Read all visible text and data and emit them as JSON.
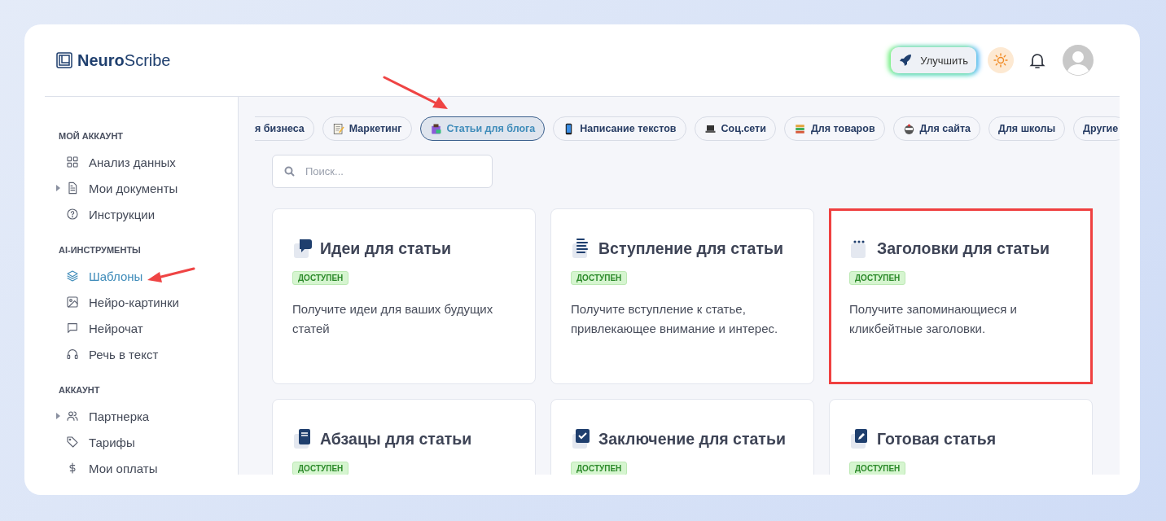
{
  "brand": {
    "logo": "**Neuro**Scribe"
  },
  "header": {
    "upgrade_button": "Улучшить"
  },
  "sidebar": {
    "sections": [
      {
        "title": "МОЙ АККАУНТ",
        "items": [
          {
            "label": "Анализ данных",
            "selected": false,
            "has_submenu": false
          },
          {
            "label": "Мои документы",
            "selected": false,
            "has_submenu": true
          },
          {
            "label": "Инструкции",
            "selected": false,
            "has_submenu": false
          }
        ]
      },
      {
        "title": "AI-ИНСТРУМЕНТЫ",
        "items": [
          {
            "label": "Шаблоны",
            "selected": true,
            "has_submenu": false
          },
          {
            "label": "Нейро-картинки",
            "selected": false,
            "has_submenu": false
          },
          {
            "label": "Нейрочат",
            "selected": false,
            "has_submenu": false
          },
          {
            "label": "Речь в текст",
            "selected": false,
            "has_submenu": false
          }
        ]
      },
      {
        "title": "АККАУНТ",
        "items": [
          {
            "label": "Партнерка",
            "selected": false,
            "has_submenu": true
          },
          {
            "label": "Тарифы",
            "selected": false,
            "has_submenu": false
          },
          {
            "label": "Мои оплаты",
            "selected": false,
            "has_submenu": false
          }
        ]
      }
    ]
  },
  "categories": [
    {
      "label": "я бизнеса",
      "selected": false
    },
    {
      "label": "Маркетинг",
      "selected": false
    },
    {
      "label": "Статьи для блога",
      "selected": true
    },
    {
      "label": "Написание текстов",
      "selected": false
    },
    {
      "label": "Соц.сети",
      "selected": false
    },
    {
      "label": "Для товаров",
      "selected": false
    },
    {
      "label": "Для сайта",
      "selected": false
    },
    {
      "label": "Для школы",
      "selected": false
    },
    {
      "label": "Другие",
      "selected": false
    }
  ],
  "search": {
    "placeholder": "Поиск..."
  },
  "templates": [
    {
      "title": "Идеи для статьи",
      "badge": "ДОСТУПЕН",
      "description": "Получите идеи для ваших будущих статей",
      "highlighted": false
    },
    {
      "title": "Вступление для статьи",
      "badge": "ДОСТУПЕН",
      "description": "Получите вступление к статье, привлекающее внимание и интерес.",
      "highlighted": false
    },
    {
      "title": "Заголовки для статьи",
      "badge": "ДОСТУПЕН",
      "description": "Получите запоминающиеся и кликбейтные заголовки.",
      "highlighted": true
    },
    {
      "title": "Абзацы для статьи",
      "badge": "ДОСТУПЕН",
      "highlighted": false
    },
    {
      "title": "Заключение для статьи",
      "badge": "ДОСТУПЕН",
      "highlighted": false
    },
    {
      "title": "Готовая статья",
      "badge": "ДОСТУПЕН",
      "highlighted": false
    }
  ]
}
